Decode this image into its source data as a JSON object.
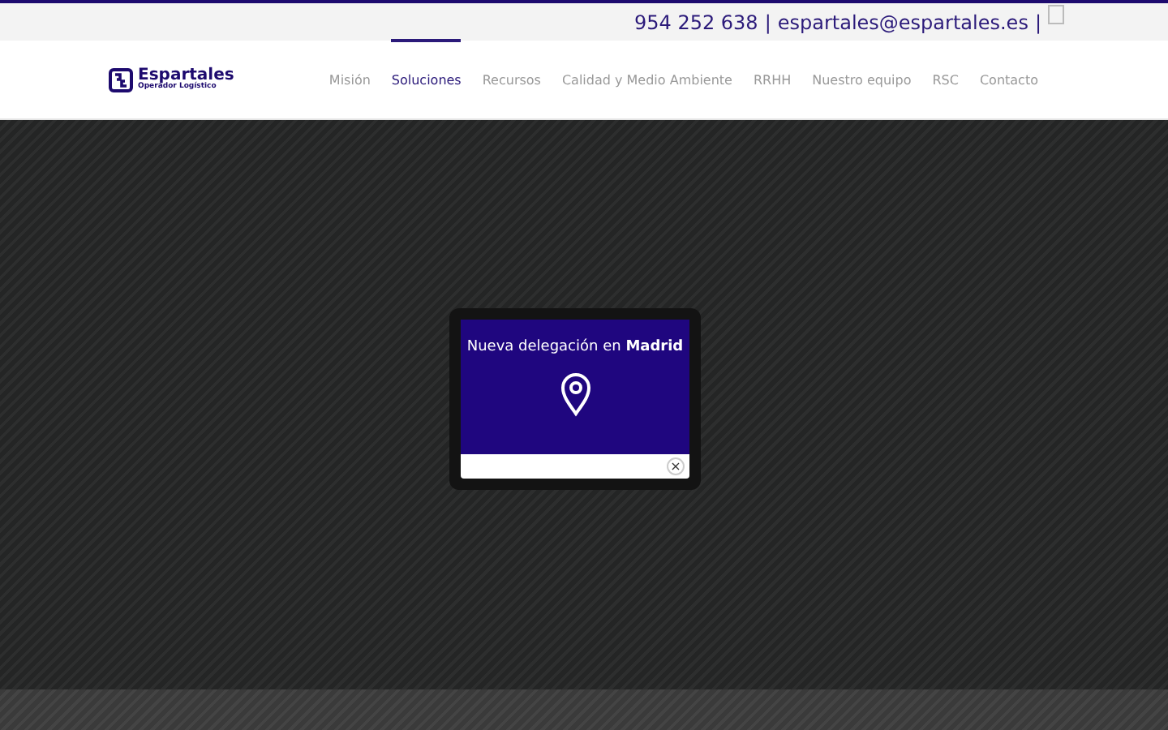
{
  "top_bar": {
    "phone": "954 252 638",
    "separator_1": "|",
    "email": "espartales@espartales.es",
    "separator_2": "|"
  },
  "logo": {
    "name": "Espartales",
    "tagline": "Operador Logístico"
  },
  "nav": [
    {
      "label": "Misión",
      "selected": false
    },
    {
      "label": "Soluciones",
      "selected": true
    },
    {
      "label": "Recursos",
      "selected": false
    },
    {
      "label": "Calidad y Medio Ambiente",
      "selected": false
    },
    {
      "label": "RRHH",
      "selected": false
    },
    {
      "label": "Nuestro equipo",
      "selected": false
    },
    {
      "label": "RSC",
      "selected": false
    },
    {
      "label": "Contacto",
      "selected": false
    }
  ],
  "popup": {
    "title": "Nueva delegación en **Madrid**",
    "close": "×"
  }
}
